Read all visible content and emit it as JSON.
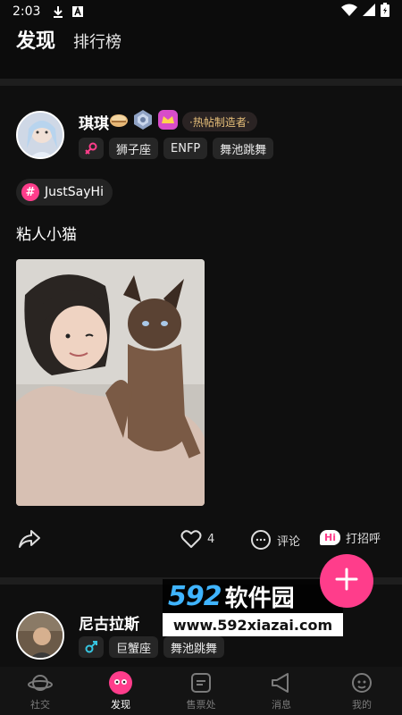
{
  "status_bar": {
    "time": "2:03"
  },
  "top_nav": {
    "tabs": [
      {
        "label": "发现"
      },
      {
        "label": "排行榜"
      }
    ]
  },
  "post": {
    "username": "琪琪",
    "hot_badge": "·热帖制造者·",
    "tags": [
      "狮子座",
      "ENFP",
      "舞池跳舞"
    ],
    "topic": "JustSayHi",
    "topic_icon": "#",
    "text": "粘人小猫",
    "like_count": "4",
    "comment_label": "评论",
    "greet_badge": "Hi",
    "greet_label": "打招呼"
  },
  "post2": {
    "username": "尼古拉斯",
    "tags": [
      "巨蟹座",
      "舞池跳舞"
    ]
  },
  "watermark": {
    "brand_num": "592",
    "brand_cn": "软件园",
    "url": "www.592xiazai.com"
  },
  "bottom_nav": {
    "items": [
      {
        "label": "社交",
        "icon": "planet-icon"
      },
      {
        "label": "发现",
        "icon": "discover-icon"
      },
      {
        "label": "售票处",
        "icon": "ticket-icon"
      },
      {
        "label": "消息",
        "icon": "megaphone-icon"
      },
      {
        "label": "我的",
        "icon": "profile-icon"
      }
    ],
    "active": "发现"
  },
  "colors": {
    "accent": "#ff3d8b",
    "background": "#0c0c0c",
    "card": "#0f0f0f"
  }
}
